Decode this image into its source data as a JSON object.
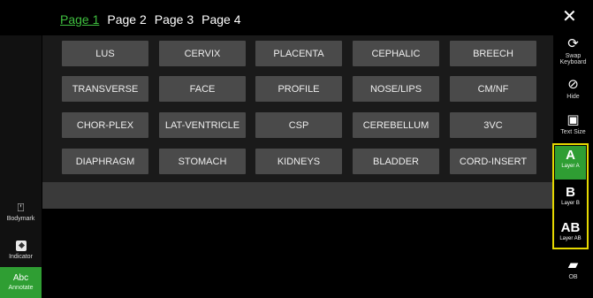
{
  "pages": [
    "Page 1",
    "Page 2",
    "Page 3",
    "Page 4"
  ],
  "active_page": "Page 1",
  "buttons": [
    "LUS",
    "CERVIX",
    "PLACENTA",
    "CEPHALIC",
    "BREECH",
    "TRANSVERSE",
    "FACE",
    "PROFILE",
    "NOSE/LIPS",
    "CM/NF",
    "CHOR-PLEX",
    "LAT-VENTRICLE",
    "CSP",
    "CEREBELLUM",
    "3VC",
    "DIAPHRAGM",
    "STOMACH",
    "KIDNEYS",
    "BLADDER",
    "CORD-INSERT"
  ],
  "left_sidebar": {
    "bodymark": "Bodymark",
    "indicator": "Indicator",
    "annotate_big": "Abc",
    "annotate": "Annotate"
  },
  "right_sidebar": {
    "close": "✕",
    "swap_keyboard": "Swap Keyboard",
    "hide": "Hide",
    "text_size": "Text Size",
    "layer_a_big": "A",
    "layer_a": "Layer A",
    "layer_b_big": "B",
    "layer_b": "Layer B",
    "layer_ab_big": "AB",
    "layer_ab": "Layer AB",
    "ob": "OB"
  },
  "colors": {
    "accent_green": "#2f9e33",
    "highlight_yellow": "#e6d800",
    "button_gray": "#4a4a4a"
  }
}
